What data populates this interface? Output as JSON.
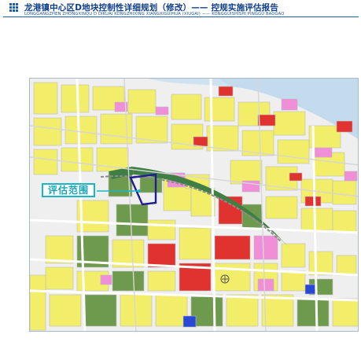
{
  "header": {
    "title_cn": "龙港镇中心区D地块控制性详细规划（修改）—— 控规实施评估报告",
    "title_en": "LONGGANGZHEN ZHONGXINQU D DIKUAI KONGZHIXING XIANGXIGUIHUA (XIUGAI) —— KONGGUISHISHI PINGGU BAOGAO",
    "icon": "grid-dots-icon",
    "accent_color": "#1a5fb4"
  },
  "map": {
    "callout_label": "评估范围",
    "callout_color": "#17b7c7",
    "boundary_color": "#1f1f8f",
    "landuse_colors": {
      "residential": "#f3ee6a",
      "commercial": "#e0332f",
      "green": "#6e9a4d",
      "public_facility": "#f08fd8",
      "water": "#c9dff0",
      "utility_blue": "#2849d6",
      "road": "#e6e6e6"
    }
  }
}
